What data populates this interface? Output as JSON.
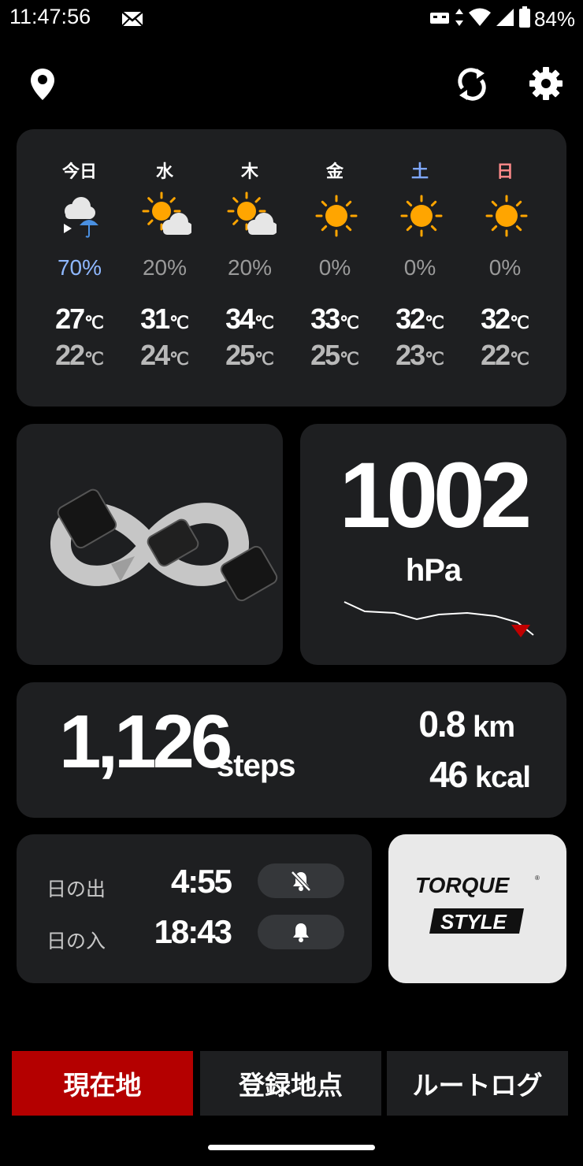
{
  "status_bar": {
    "time": "11:47:56",
    "battery": "84%"
  },
  "forecast": [
    {
      "day": "今日",
      "day_color": "#ffffff",
      "icon": "cloud-rain-icon",
      "rain": "70%",
      "rain_color": "#8fb8ff",
      "high": "27",
      "low": "22"
    },
    {
      "day": "水",
      "day_color": "#ffffff",
      "icon": "sun-cloud-icon",
      "rain": "20%",
      "rain_color": "#9a9a9a",
      "high": "31",
      "low": "24"
    },
    {
      "day": "木",
      "day_color": "#ffffff",
      "icon": "sun-cloud-icon",
      "rain": "20%",
      "rain_color": "#9a9a9a",
      "high": "34",
      "low": "25"
    },
    {
      "day": "金",
      "day_color": "#ffffff",
      "icon": "sun-icon",
      "rain": "0%",
      "rain_color": "#9a9a9a",
      "high": "33",
      "low": "25"
    },
    {
      "day": "土",
      "day_color": "#7fa8ff",
      "icon": "sun-icon",
      "rain": "0%",
      "rain_color": "#9a9a9a",
      "high": "32",
      "low": "23"
    },
    {
      "day": "日",
      "day_color": "#ff8a8a",
      "icon": "sun-icon",
      "rain": "0%",
      "rain_color": "#9a9a9a",
      "high": "32",
      "low": "22"
    }
  ],
  "temp_unit": "℃",
  "pressure": {
    "value": "1002",
    "unit": "hPa",
    "trend": "falling"
  },
  "steps": {
    "count": "1,126",
    "unit": "steps",
    "distance": "0.8",
    "distance_unit": "km",
    "calories": "46",
    "calories_unit": "kcal"
  },
  "sun": {
    "sunrise_label": "日の出",
    "sunrise_time": "4:55",
    "sunrise_alarm": "off",
    "sunset_label": "日の入",
    "sunset_time": "18:43",
    "sunset_alarm": "on"
  },
  "brand": {
    "line1": "TORQUE",
    "line2": "STYLE"
  },
  "tabs": [
    {
      "label": "現在地",
      "active": true
    },
    {
      "label": "登録地点",
      "active": false
    },
    {
      "label": "ルートログ",
      "active": false
    }
  ],
  "colors": {
    "accent": "#b40000",
    "card": "#1e1f21",
    "sun": "#ffa500"
  }
}
